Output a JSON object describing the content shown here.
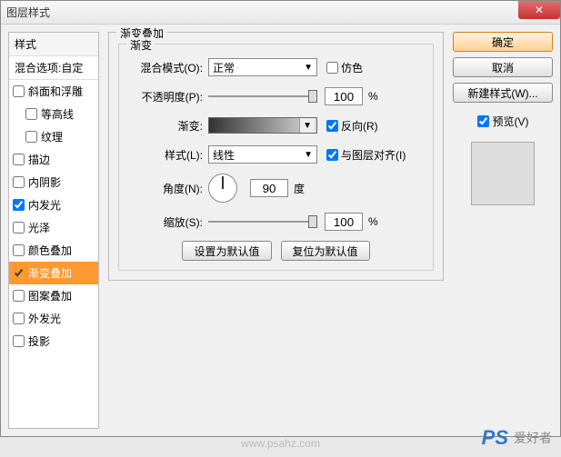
{
  "window": {
    "title": "图层样式"
  },
  "sidebar": {
    "header": "样式",
    "sub": "混合选项:自定",
    "items": [
      {
        "label": "斜面和浮雕",
        "checked": false,
        "indent": false
      },
      {
        "label": "等高线",
        "checked": false,
        "indent": true
      },
      {
        "label": "纹理",
        "checked": false,
        "indent": true
      },
      {
        "label": "描边",
        "checked": false,
        "indent": false
      },
      {
        "label": "内阴影",
        "checked": false,
        "indent": false
      },
      {
        "label": "内发光",
        "checked": true,
        "indent": false
      },
      {
        "label": "光泽",
        "checked": false,
        "indent": false
      },
      {
        "label": "颜色叠加",
        "checked": false,
        "indent": false
      },
      {
        "label": "渐变叠加",
        "checked": true,
        "indent": false,
        "selected": true
      },
      {
        "label": "图案叠加",
        "checked": false,
        "indent": false
      },
      {
        "label": "外发光",
        "checked": false,
        "indent": false
      },
      {
        "label": "投影",
        "checked": false,
        "indent": false
      }
    ]
  },
  "main": {
    "group_title": "渐变叠加",
    "inner_title": "渐变",
    "blend_mode": {
      "label": "混合模式(O):",
      "value": "正常"
    },
    "dither": {
      "label": "仿色",
      "checked": false
    },
    "opacity": {
      "label": "不透明度(P):",
      "value": "100",
      "unit": "%"
    },
    "gradient": {
      "label": "渐变:"
    },
    "reverse": {
      "label": "反向(R)",
      "checked": true
    },
    "style": {
      "label": "样式(L):",
      "value": "线性"
    },
    "align": {
      "label": "与图层对齐(I)",
      "checked": true
    },
    "angle": {
      "label": "角度(N):",
      "value": "90",
      "unit": "度"
    },
    "scale": {
      "label": "缩放(S):",
      "value": "100",
      "unit": "%"
    },
    "btn_default": "设置为默认值",
    "btn_reset": "复位为默认值"
  },
  "right": {
    "ok": "确定",
    "cancel": "取消",
    "new_style": "新建样式(W)...",
    "preview": {
      "label": "预览(V)",
      "checked": true
    }
  },
  "watermark": {
    "logo": "PS",
    "cn": "爱好者",
    "url": "www.psahz.com"
  }
}
